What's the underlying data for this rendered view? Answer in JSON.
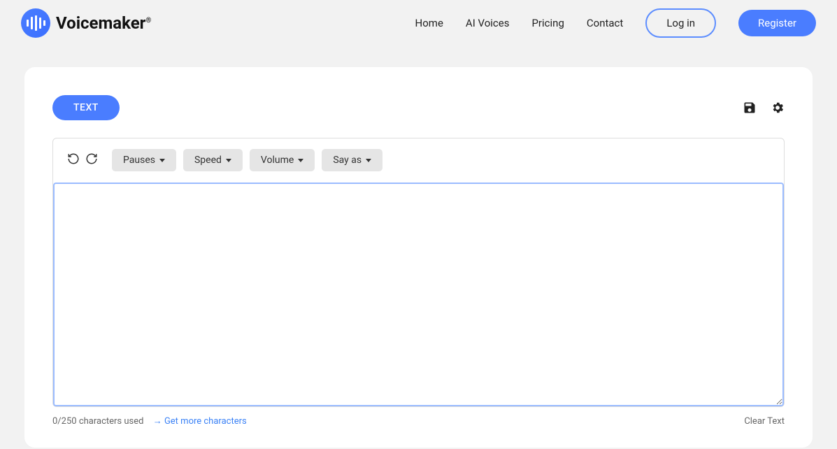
{
  "header": {
    "brand": "Voicemaker",
    "brand_suffix": "®",
    "nav": {
      "home": "Home",
      "ai_voices": "AI Voices",
      "pricing": "Pricing",
      "contact": "Contact"
    },
    "login": "Log in",
    "register": "Register"
  },
  "main": {
    "text_tab": "TEXT",
    "toolbar": {
      "pauses": "Pauses",
      "speed": "Speed",
      "volume": "Volume",
      "say_as": "Say as"
    },
    "textarea_value": "",
    "footer": {
      "char_count": "0/250 characters used",
      "more_chars": "Get more characters",
      "clear": "Clear Text"
    }
  }
}
